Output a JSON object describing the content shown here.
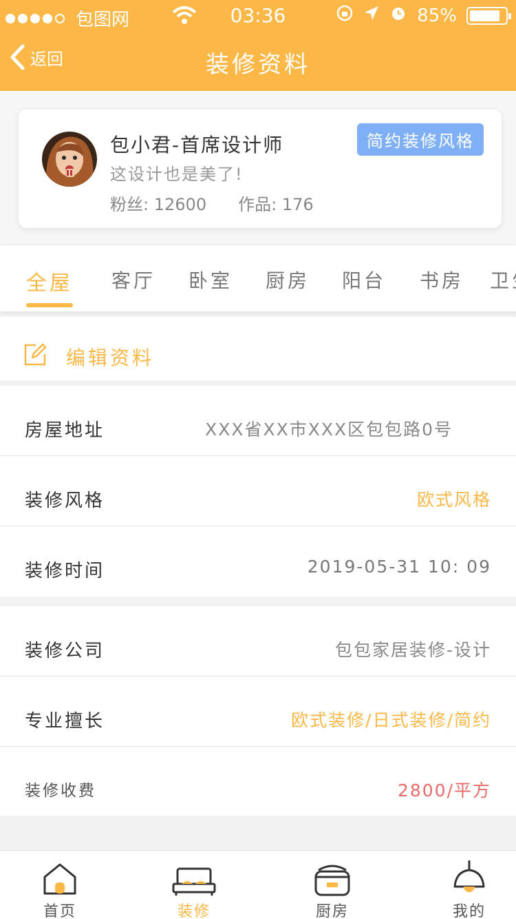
{
  "status_bar": {
    "carrier": "包图网",
    "time": "03:36",
    "battery": "85%"
  },
  "nav": {
    "back_label": "返回",
    "title": "装修资料"
  },
  "designer": {
    "name": "包小君-首席设计师",
    "slogan": "这设计也是美了!",
    "fans_label": "粉丝:",
    "fans_value": "12600",
    "works_label": "作品:",
    "works_value": "176",
    "style_badge": "简约装修风格"
  },
  "tabs": [
    "全屋",
    "客厅",
    "卧室",
    "厨房",
    "阳台",
    "书房",
    "卫生"
  ],
  "edit": {
    "label": "编辑资料"
  },
  "info_group_1": [
    {
      "label": "房屋地址",
      "value": "XXX省XX市XXX区包包路0号"
    },
    {
      "label": "装修风格",
      "value": "欧式风格"
    },
    {
      "label": "装修时间",
      "value": "2019-05-31 10: 09"
    }
  ],
  "info_group_2": [
    {
      "label": "装修公司",
      "value": "包包家居装修-设计"
    },
    {
      "label": "专业擅长",
      "value": "欧式装修/日式装修/简约"
    },
    {
      "label": "装修收费",
      "value": "2800/平方"
    }
  ],
  "tabbar": [
    {
      "label": "首页",
      "icon": "home-icon"
    },
    {
      "label": "装修",
      "icon": "bed-icon"
    },
    {
      "label": "厨房",
      "icon": "pot-icon"
    },
    {
      "label": "我的",
      "icon": "lamp-icon"
    }
  ],
  "colors": {
    "accent": "#fbb847",
    "badge": "#7fb0f5",
    "price": "#e86a6a"
  }
}
